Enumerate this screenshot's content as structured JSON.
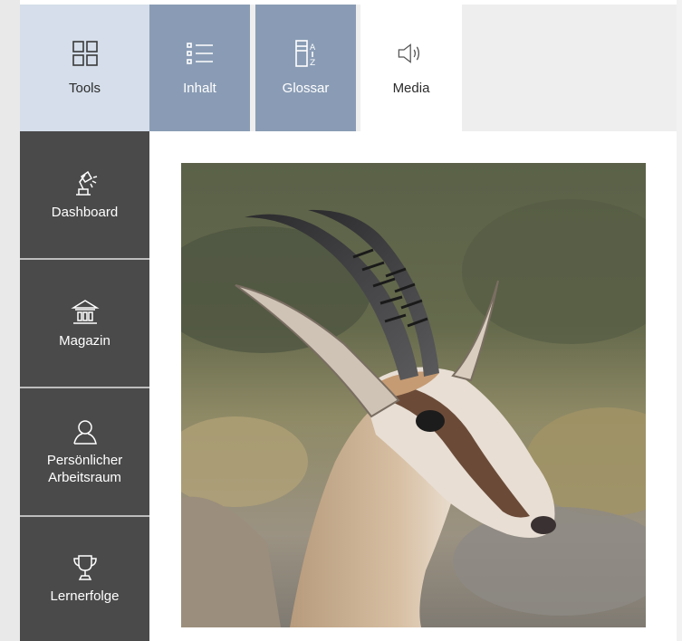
{
  "tabs": {
    "tools": {
      "label": "Tools",
      "icon": "grid-icon"
    },
    "inhalt": {
      "label": "Inhalt",
      "icon": "list-icon"
    },
    "glossar": {
      "label": "Glossar",
      "icon": "glossary-az-icon"
    },
    "media": {
      "label": "Media",
      "icon": "speaker-icon"
    }
  },
  "sidebar": {
    "items": [
      {
        "label": "Dashboard",
        "icon": "desk-lamp-icon"
      },
      {
        "label": "Magazin",
        "icon": "building-icon"
      },
      {
        "label": "Persönlicher Arbeitsraum",
        "line1": "Persönlicher",
        "line2": "Arbeitsraum",
        "icon": "user-icon"
      },
      {
        "label": "Lernerfolge",
        "icon": "trophy-icon"
      }
    ]
  },
  "colors": {
    "tab_active_light": "#d5deea",
    "tab_blue": "#8a9cb5",
    "sidebar_bg": "#4a4a4a"
  },
  "main": {
    "image_subject": "springbok-photo"
  }
}
